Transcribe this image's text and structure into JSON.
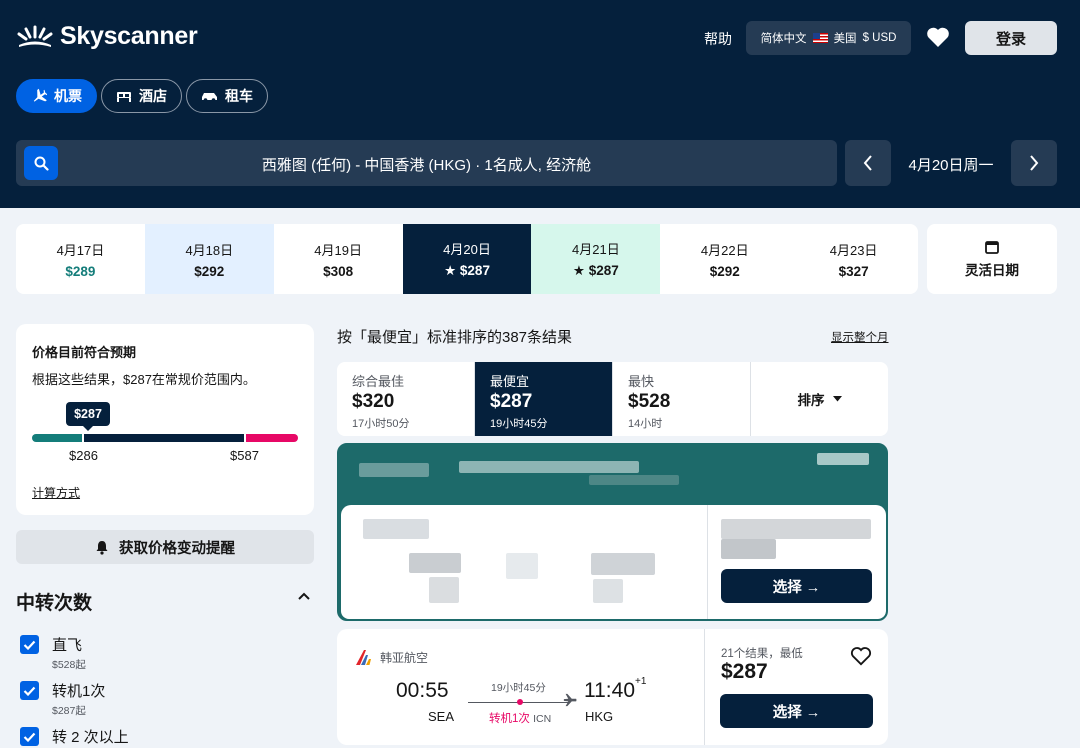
{
  "header": {
    "logo_text": "Skyscanner",
    "help": "帮助",
    "language": "简体中文",
    "country": "美国",
    "currency": "$ USD",
    "login": "登录"
  },
  "tabs": [
    {
      "label": "机票",
      "icon": "plane-icon",
      "active": true
    },
    {
      "label": "酒店",
      "icon": "bed-icon",
      "active": false
    },
    {
      "label": "租车",
      "icon": "car-icon",
      "active": false
    }
  ],
  "search": {
    "summary": "西雅图 (任何) - 中国香港 (HKG) · 1名成人, 经济舱",
    "current_date": "4月20日周一"
  },
  "date_strip": [
    {
      "date": "4月17日",
      "price": "$289",
      "state": "cheap"
    },
    {
      "date": "4月18日",
      "price": "$292",
      "state": "light"
    },
    {
      "date": "4月19日",
      "price": "$308",
      "state": "normal"
    },
    {
      "date": "4月20日",
      "price": "★ $287",
      "state": "selected"
    },
    {
      "date": "4月21日",
      "price": "★ $287",
      "state": "best"
    },
    {
      "date": "4月22日",
      "price": "$292",
      "state": "normal"
    },
    {
      "date": "4月23日",
      "price": "$327",
      "state": "normal"
    }
  ],
  "flexible_dates": "灵活日期",
  "price_insight": {
    "title": "价格目前符合预期",
    "description": "根据这些结果，$287在常规价范围内。",
    "current": "$287",
    "low": "$286",
    "high": "$587",
    "calc_link": "计算方式"
  },
  "price_alert": "获取价格变动提醒",
  "filters": {
    "stops_title": "中转次数",
    "options": [
      {
        "label": "直飞",
        "sub": "$528起",
        "checked": true
      },
      {
        "label": "转机1次",
        "sub": "$287起",
        "checked": true
      },
      {
        "label": "转 2 次以上",
        "sub": "",
        "checked": true
      }
    ]
  },
  "results": {
    "title": "按「最便宜」标准排序的387条结果",
    "month_link": "显示整个月"
  },
  "sort_options": [
    {
      "label": "综合最佳",
      "price": "$320",
      "duration": "17小时50分",
      "active": false
    },
    {
      "label": "最便宜",
      "price": "$287",
      "duration": "19小时45分",
      "active": true
    },
    {
      "label": "最快",
      "price": "$528",
      "duration": "14小时",
      "active": false
    }
  ],
  "sort_dropdown": "排序",
  "ad_card": {
    "select": "选择 →"
  },
  "flight": {
    "airline": "韩亚航空",
    "depart_time": "00:55",
    "depart_code": "SEA",
    "duration": "19小时45分",
    "stops": "转机1次",
    "stop_airport": "ICN",
    "arrive_time": "11:40",
    "arrive_day_offset": "+1",
    "arrive_code": "HKG",
    "deals": "21个结果，最低",
    "price": "$287",
    "select": "选择 →"
  },
  "colors": {
    "nav_bg": "#05203c",
    "accent_blue": "#0062e3",
    "alert_pink": "#e70866",
    "ad_teal": "#1d6a6a",
    "best_green": "#d6f7ec",
    "cheap_teal": "#147d7a"
  }
}
